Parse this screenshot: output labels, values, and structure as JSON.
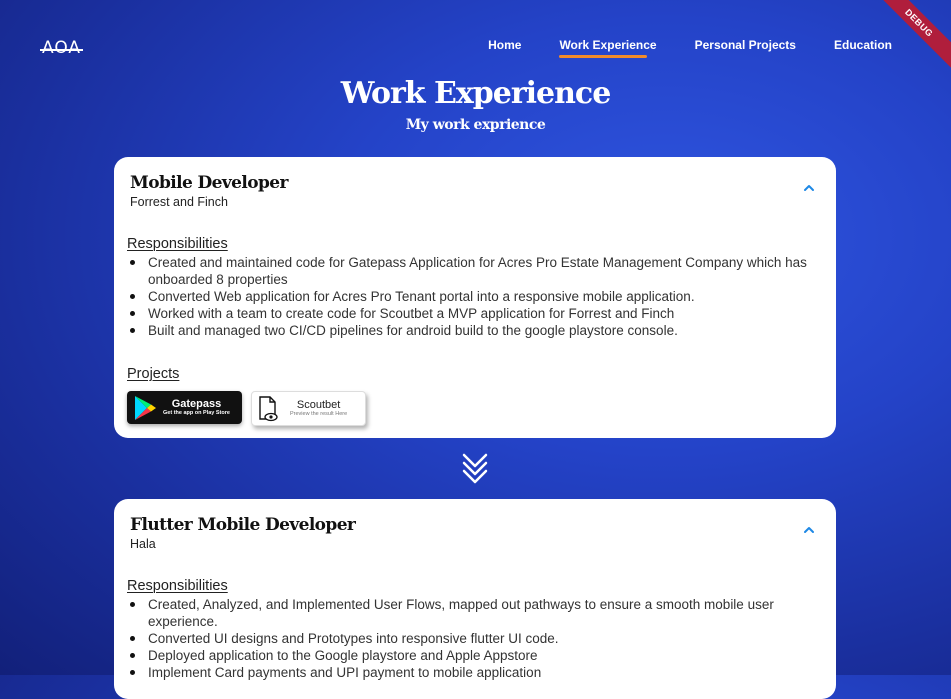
{
  "header": {
    "logo": "AOA",
    "nav": [
      {
        "label": "Home",
        "active": false
      },
      {
        "label": "Work Experience",
        "active": true
      },
      {
        "label": "Personal Projects",
        "active": false
      },
      {
        "label": "Education",
        "active": false
      }
    ],
    "debug_badge": "DEBUG"
  },
  "page": {
    "title": "Work Experience",
    "subtitle": "My work exprience"
  },
  "colors": {
    "accent_underline": "#f28b2a",
    "chevron": "#1e88e5",
    "background": "#2443c8",
    "debug_ribbon": "#b01e3c"
  },
  "jobs": [
    {
      "title": "Mobile Developer",
      "company": "Forrest and Finch",
      "responsibilities_label": "Responsibilities",
      "responsibilities": [
        "Created and maintained code for Gatepass Application for Acres Pro Estate Management Company which has onboarded 8 properties",
        "Converted Web application for Acres Pro Tenant portal into a responsive mobile application.",
        "Worked with a team to create code for Scoutbet a MVP application for Forrest and Finch",
        "Built and managed two CI/CD pipelines for android build to the google playstore console."
      ],
      "projects_label": "Projects",
      "projects": [
        {
          "title": "Gatepass",
          "subtitle": "Get the app on Play Store",
          "icon": "google-play-icon"
        },
        {
          "title": "Scoutbet",
          "subtitle": "Preview the result Here",
          "icon": "document-preview-icon"
        }
      ]
    },
    {
      "title": "Flutter Mobile Developer",
      "company": "Hala",
      "responsibilities_label": "Responsibilities",
      "responsibilities": [
        "Created, Analyzed, and Implemented User Flows, mapped out pathways to ensure a smooth mobile user experience.",
        "Converted UI designs and Prototypes into responsive flutter UI code.",
        "Deployed application to the Google playstore and Apple Appstore",
        "Implement Card payments and UPI payment to mobile application"
      ]
    }
  ]
}
